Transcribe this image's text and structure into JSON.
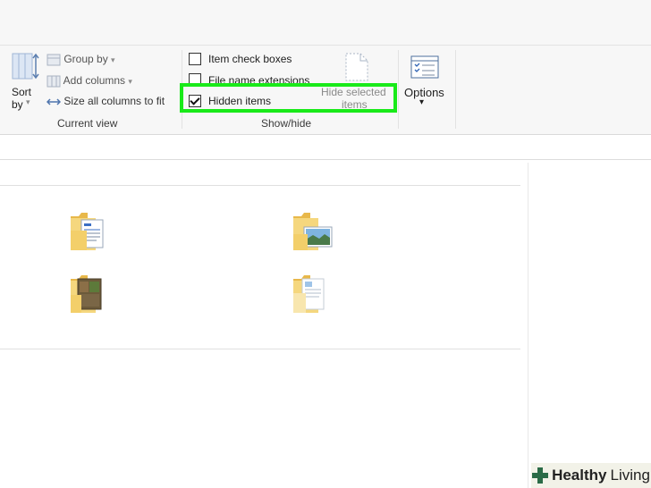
{
  "ribbon": {
    "current_view": {
      "sort_by_label": "Sort",
      "sort_by_label2": "by",
      "group_by": "Group by",
      "add_columns": "Add columns",
      "size_all_columns": "Size all columns to fit",
      "group_label": "Current view"
    },
    "show_hide": {
      "item_check_boxes": "Item check boxes",
      "item_check_boxes_checked": false,
      "file_name_extensions": "File name extensions",
      "file_name_extensions_checked": false,
      "hidden_items": "Hidden items",
      "hidden_items_checked": true,
      "hide_selected_line1": "Hide selected",
      "hide_selected_line2": "items",
      "group_label": "Show/hide"
    },
    "options": {
      "label": "Options",
      "arrow": "▾"
    }
  },
  "folders": [
    {
      "icon": "document-folder-icon"
    },
    {
      "icon": "pictures-folder-icon"
    },
    {
      "icon": "photo-folder-icon"
    },
    {
      "icon": "files-folder-icon"
    }
  ],
  "watermark": {
    "bold": "Healthy",
    "light": "Living"
  },
  "colors": {
    "highlight": "#19ea19",
    "folder": "#f5d77e"
  }
}
